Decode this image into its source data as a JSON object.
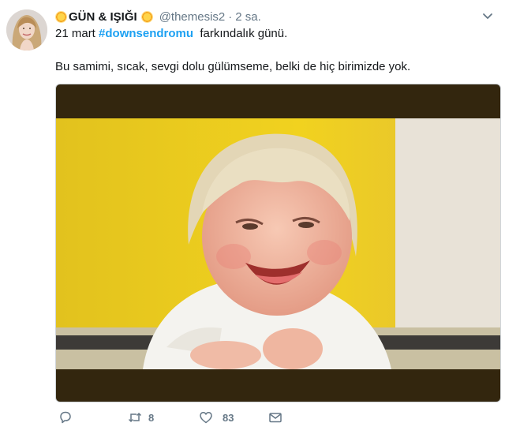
{
  "tweet": {
    "display_name_emoji": "sun-emoji",
    "display_name": "GÜN & IŞIĞI",
    "handle": "@themesis2",
    "separator": "·",
    "timestamp": "2 sa.",
    "line1_prefix": "21 mart ",
    "hashtag": "#downsendromu",
    "line1_suffix": "  farkındalık günü.",
    "body": "Bu samimi, sıcak, sevgi dolu gülümseme, belki de hiç birimizde yok.",
    "media_icon": "photo",
    "actions": {
      "reply_icon": "reply-icon",
      "retweet_icon": "retweet-icon",
      "retweet_count": "8",
      "like_icon": "heart-icon",
      "like_count": "83",
      "dm_icon": "envelope-icon"
    }
  },
  "colors": {
    "accent": "#1da1f2",
    "muted": "#657786",
    "text": "#14171a"
  }
}
